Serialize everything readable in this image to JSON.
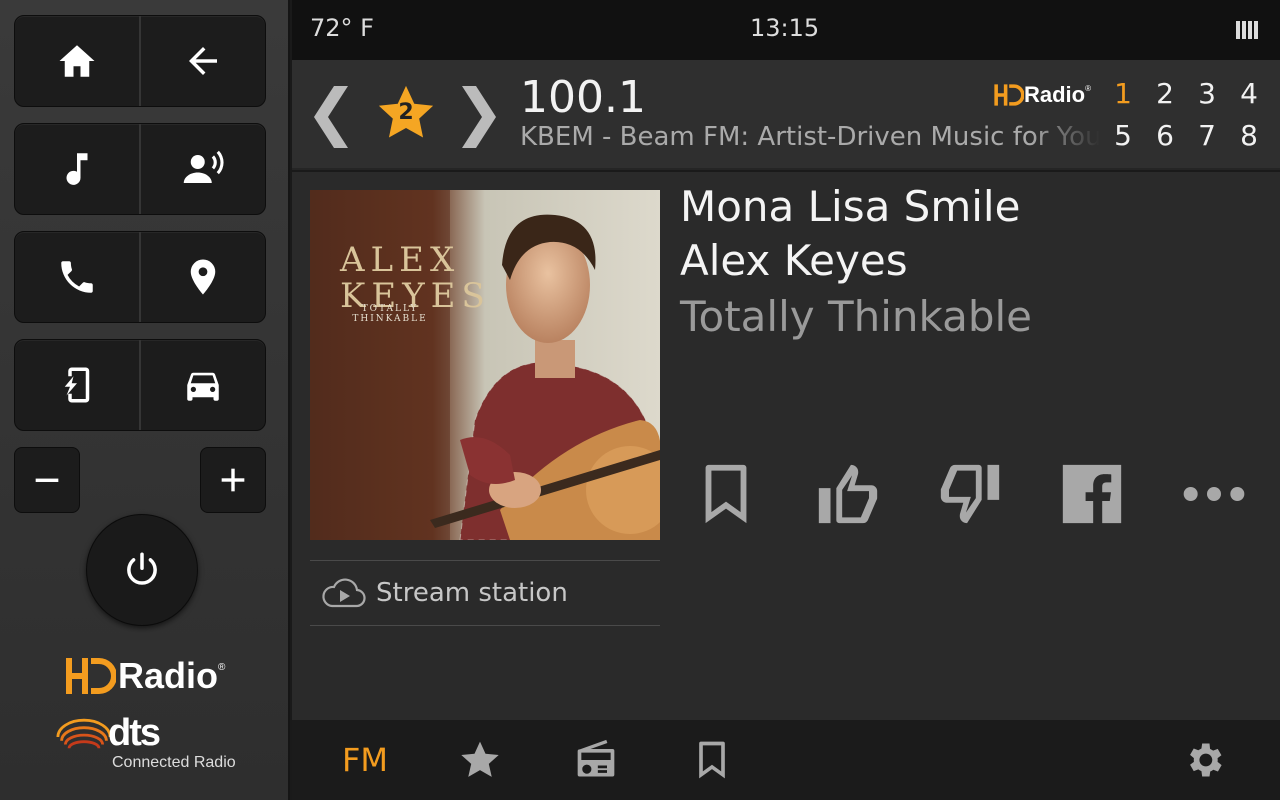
{
  "status_bar": {
    "temperature": "72° F",
    "time": "13:15"
  },
  "station": {
    "frequency": "100.1",
    "description": "KBEM - Beam FM: Artist-Driven Music for You",
    "preset_number": "2",
    "hd_label": "Radio",
    "hd_prefix": "HD",
    "reg_mark": "®"
  },
  "presets": [
    "1",
    "2",
    "3",
    "4",
    "5",
    "6",
    "7",
    "8"
  ],
  "active_preset": "1",
  "now_playing": {
    "title": "Mona Lisa Smile",
    "artist": "Alex Keyes",
    "album": "Totally Thinkable",
    "art_artist_text": "ALEX KEYES",
    "art_album_text": "TOTALLY THINKABLE"
  },
  "stream": {
    "label": "Stream station"
  },
  "logos": {
    "hd_radio": "Radio",
    "hd_reg": "®",
    "dts": "dts",
    "dts_sub": "Connected Radio"
  },
  "bottom_nav": {
    "fm_label": "FM"
  },
  "colors": {
    "accent": "#f39c1f",
    "star": "#f5a623",
    "background": "#2a2a2a"
  },
  "icons": {
    "left_panel": [
      "home-icon",
      "back-arrow-icon",
      "music-note-icon",
      "voice-command-icon",
      "phone-icon",
      "location-pin-icon",
      "phone-charge-icon",
      "car-icon",
      "minus-icon",
      "plus-icon",
      "power-icon"
    ],
    "actions": [
      "bookmark-icon",
      "thumbs-up-icon",
      "thumbs-down-icon",
      "facebook-icon",
      "more-icon"
    ],
    "bottom_nav": [
      "star-icon",
      "radio-icon",
      "bookmark-icon",
      "gear-icon"
    ]
  }
}
